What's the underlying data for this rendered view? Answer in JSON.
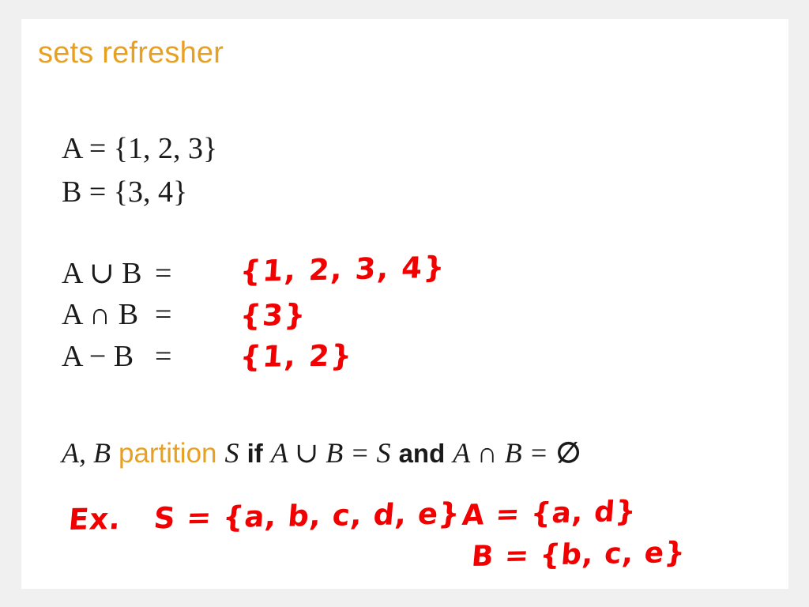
{
  "slide": {
    "title": "sets refresher",
    "background_color": "#ffffff",
    "canvas_color": "#f0f0f0",
    "accent_color": "#E8A023",
    "ink_color": "#F20000",
    "text_color": "#1a1a1a"
  },
  "definitions": [
    {
      "name": "set-a-definition",
      "text": "A  =  {1, 2, 3}"
    },
    {
      "name": "set-b-definition",
      "text": "B  =  {3, 4}"
    }
  ],
  "operations": [
    {
      "name": "union",
      "lhs": "A ∪ B",
      "equals": "=",
      "answer": "{1, 2, 3, 4}"
    },
    {
      "name": "intersection",
      "lhs": "A ∩ B",
      "equals": "=",
      "answer": "{3}"
    },
    {
      "name": "difference",
      "lhs": "A − B",
      "equals": "=",
      "answer": "{1, 2}"
    }
  ],
  "partition_statement": {
    "sets": "A, B",
    "keyword": "partition",
    "universe": "S",
    "if_word": "if",
    "union_expr": "A ∪ B = S",
    "and_word": "and",
    "intersection_expr": "A ∩ B =",
    "empty_set": "∅"
  },
  "example": {
    "label": "Ex.",
    "universe_line": "S = {a, b, c, d, e}",
    "set_a_line": "A = {a, d}",
    "set_b_line": "B = {b, c, e}"
  }
}
